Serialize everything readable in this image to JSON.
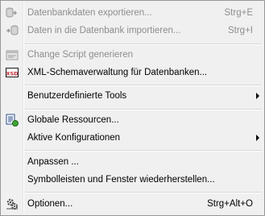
{
  "menu": {
    "items": [
      {
        "label": "Datenbankdaten exportieren...",
        "shortcut": "Strg+E",
        "icon": "export-database-icon",
        "disabled": true
      },
      {
        "label": "Daten in die Datenbank importieren...",
        "shortcut": "Strg+I",
        "icon": "import-database-icon",
        "disabled": true
      },
      {
        "label": "Change Script generieren",
        "icon": "change-script-icon",
        "disabled": true
      },
      {
        "label": "XML-Schemaverwaltung für Datenbanken...",
        "icon": "xml-schema-icon",
        "disabled": false
      },
      {
        "label": "Benutzerdefinierte Tools",
        "submenu": true,
        "disabled": false
      },
      {
        "label": "Globale Ressourcen...",
        "icon": "global-resources-icon",
        "disabled": false
      },
      {
        "label": "Aktive Konfigurationen",
        "submenu": true,
        "disabled": false
      },
      {
        "label": "Anpassen ...",
        "disabled": false
      },
      {
        "label": "Symbolleisten und Fenster wiederherstellen...",
        "disabled": false
      },
      {
        "label": "Optionen...",
        "shortcut": "Strg+Alt+O",
        "icon": "options-icon",
        "disabled": false
      }
    ]
  }
}
